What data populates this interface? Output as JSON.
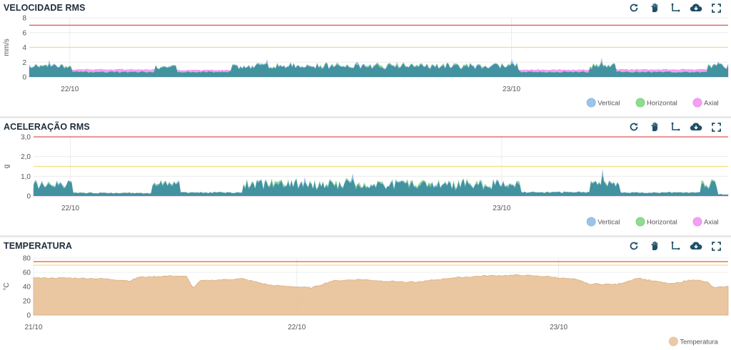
{
  "colors": {
    "vertical": "#8db8e4",
    "horizontal": "#7cd37e",
    "axial": "#f18ef0",
    "teal": "#3f8f9c",
    "alarm": "#e05454",
    "warning": "#f1e07a",
    "grid": "#ececec",
    "temperatura": "#e8c197",
    "icon": "#1f4e68"
  },
  "toolbar": {
    "icons": [
      "reset-icon",
      "pan-hand-icon",
      "axis-zoom-icon",
      "cloud-download-icon",
      "fullscreen-icon"
    ]
  },
  "chart_data": [
    {
      "type": "area",
      "title": "VELOCIDADE RMS",
      "ylabel": "mm/s",
      "ylim": [
        0,
        8
      ],
      "yticks": [
        "0",
        "2",
        "4",
        "6",
        "8"
      ],
      "xticks": [
        "22/10",
        "23/10"
      ],
      "thresholds": {
        "alarm": 7,
        "warning": 4
      },
      "legend": [
        "Vertical",
        "Horizontal",
        "Axial"
      ],
      "legend_position": "bottom-right",
      "segments": [
        {
          "x0": 0.0,
          "x1": 0.06,
          "level": 1.5,
          "amp": 0.3
        },
        {
          "x0": 0.06,
          "x1": 0.18,
          "level": 0.7,
          "amp": 0.1,
          "axial_high": 1.0
        },
        {
          "x0": 0.18,
          "x1": 0.21,
          "level": 1.4,
          "amp": 0.25
        },
        {
          "x0": 0.21,
          "x1": 0.29,
          "level": 0.7,
          "amp": 0.1,
          "axial_high": 0.9
        },
        {
          "x0": 0.29,
          "x1": 0.7,
          "level": 1.5,
          "amp": 0.4
        },
        {
          "x0": 0.7,
          "x1": 0.8,
          "level": 0.7,
          "amp": 0.1,
          "axial_high": 0.95
        },
        {
          "x0": 0.8,
          "x1": 0.84,
          "level": 1.5,
          "amp": 0.35
        },
        {
          "x0": 0.84,
          "x1": 0.97,
          "level": 0.7,
          "amp": 0.1,
          "axial_high": 1.0
        },
        {
          "x0": 0.97,
          "x1": 1.0,
          "level": 1.5,
          "amp": 0.4
        }
      ],
      "spikes": [
        {
          "x": 0.028,
          "y": 2.3
        },
        {
          "x": 0.34,
          "y": 2.4
        },
        {
          "x": 0.47,
          "y": 2.1
        },
        {
          "x": 0.69,
          "y": 2.4
        },
        {
          "x": 0.82,
          "y": 2.6
        },
        {
          "x": 0.985,
          "y": 2.1
        }
      ]
    },
    {
      "type": "area",
      "title": "ACELERAÇÃO RMS",
      "ylabel": "g",
      "ylim": [
        0,
        3.0
      ],
      "yticks": [
        "0",
        "1,0",
        "2,0",
        "3,0"
      ],
      "xticks": [
        "22/10",
        "23/10"
      ],
      "thresholds": {
        "alarm": 3.0,
        "warning": 1.5
      },
      "legend": [
        "Vertical",
        "Horizontal",
        "Axial"
      ],
      "legend_position": "bottom-right",
      "segments": [
        {
          "x0": 0.0,
          "x1": 0.055,
          "level": 0.6,
          "amp": 0.2
        },
        {
          "x0": 0.055,
          "x1": 0.17,
          "level": 0.15,
          "amp": 0.03
        },
        {
          "x0": 0.17,
          "x1": 0.21,
          "level": 0.65,
          "amp": 0.15
        },
        {
          "x0": 0.21,
          "x1": 0.3,
          "level": 0.18,
          "amp": 0.03
        },
        {
          "x0": 0.3,
          "x1": 0.7,
          "level": 0.6,
          "amp": 0.25
        },
        {
          "x0": 0.7,
          "x1": 0.8,
          "level": 0.2,
          "amp": 0.04
        },
        {
          "x0": 0.8,
          "x1": 0.845,
          "level": 0.65,
          "amp": 0.15
        },
        {
          "x0": 0.845,
          "x1": 0.96,
          "level": 0.18,
          "amp": 0.03
        },
        {
          "x0": 0.96,
          "x1": 0.985,
          "level": 0.55,
          "amp": 0.25
        },
        {
          "x0": 0.985,
          "x1": 1.0,
          "level": 0.08,
          "amp": 0.02
        }
      ],
      "spikes": [
        {
          "x": 0.39,
          "y": 0.95
        },
        {
          "x": 0.46,
          "y": 1.15
        },
        {
          "x": 0.82,
          "y": 1.4
        },
        {
          "x": 0.975,
          "y": 0.8
        }
      ]
    },
    {
      "type": "area",
      "title": "TEMPERATURA",
      "ylabel": "°C",
      "ylim": [
        0,
        80
      ],
      "yticks": [
        "0",
        "20",
        "40",
        "60",
        "80"
      ],
      "xticks": [
        "21/10",
        "22/10",
        "23/10"
      ],
      "thresholds": {
        "alarm": 75,
        "warning": 70
      },
      "legend": [
        "Temperatura"
      ],
      "legend_position": "bottom-right",
      "x": [
        0.0,
        0.01,
        0.05,
        0.1,
        0.14,
        0.15,
        0.2,
        0.22,
        0.23,
        0.24,
        0.3,
        0.34,
        0.37,
        0.4,
        0.43,
        0.47,
        0.5,
        0.55,
        0.6,
        0.65,
        0.7,
        0.74,
        0.78,
        0.8,
        0.84,
        0.87,
        0.89,
        0.92,
        0.95,
        0.97,
        0.98,
        1.0
      ],
      "values": [
        53,
        52,
        52,
        51,
        48,
        53,
        55,
        54,
        38,
        48,
        51,
        42,
        40,
        38,
        48,
        50,
        48,
        46,
        52,
        55,
        56,
        54,
        50,
        44,
        43,
        52,
        48,
        44,
        50,
        46,
        38,
        40
      ]
    }
  ]
}
